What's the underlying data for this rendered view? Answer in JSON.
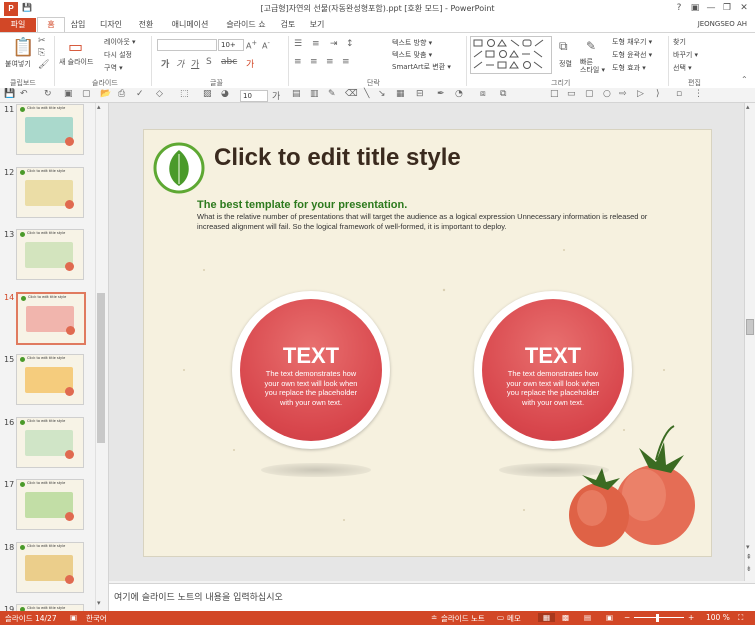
{
  "window": {
    "title": "[고급형]자연의 선물(자동완성형포함).ppt [호환 모드] - PowerPoint",
    "user": "JEONGSEO AH",
    "controls": [
      "?",
      "▣",
      "—",
      "❐",
      "✕"
    ]
  },
  "tabs": [
    {
      "label": "파일"
    },
    {
      "label": "홈"
    },
    {
      "label": "삽입"
    },
    {
      "label": "디자인"
    },
    {
      "label": "전환"
    },
    {
      "label": "애니메이션"
    },
    {
      "label": "슬라이드 쇼"
    },
    {
      "label": "검토"
    },
    {
      "label": "보기"
    }
  ],
  "ribbon": {
    "clipboard": {
      "paste": "붙여넣기",
      "group": "클립보드"
    },
    "slides": {
      "new_slide": "새 슬라이드",
      "layout": "레이아웃 ▾",
      "reset": "다시 설정",
      "section": "구역 ▾",
      "group": "슬라이드"
    },
    "font": {
      "size": "10+",
      "group": "글꼴"
    },
    "paragraph": {
      "text_direction": "텍스트 방향 ▾",
      "align_text": "텍스트 맞춤 ▾",
      "smartart": "SmartArt로 변환 ▾",
      "group": "단락"
    },
    "drawing": {
      "arrange": "정렬",
      "quick_styles": "빠른\n스타일 ▾",
      "fill": "도형 채우기 ▾",
      "outline": "도형 윤곽선 ▾",
      "effects": "도형 효과 ▾",
      "group": "그리기"
    },
    "editing": {
      "find": "찾기",
      "replace": "바꾸기 ▾",
      "select": "선택 ▾",
      "group": "편집"
    }
  },
  "qat": {
    "font_size": "10"
  },
  "thumbnails": [
    {
      "num": "11",
      "selected": false
    },
    {
      "num": "12",
      "selected": false
    },
    {
      "num": "13",
      "selected": false
    },
    {
      "num": "14",
      "selected": true
    },
    {
      "num": "15",
      "selected": false
    },
    {
      "num": "16",
      "selected": false
    },
    {
      "num": "17",
      "selected": false
    },
    {
      "num": "18",
      "selected": false
    },
    {
      "num": "19",
      "selected": false
    }
  ],
  "thumb_caption": "Click to edit title style",
  "slide": {
    "title": "Click to edit title style",
    "subtitle": "The best template for your presentation.",
    "body": "What is the relative number of presentations that will target the audience as a logical expression Unnecessary information is released or increased alignment will fail. So the logical framework of well-formed, it is important to deploy.",
    "circles": [
      {
        "title": "TEXT",
        "body": "The text demonstrates how your own text will look when you replace the placeholder with your own text."
      },
      {
        "title": "TEXT",
        "body": "The text demonstrates how your own text will look when you replace the placeholder with your own text."
      }
    ]
  },
  "notes": {
    "placeholder": "여기에 슬라이드 노트의 내용을 입력하십시오"
  },
  "status": {
    "slide_pos": "슬라이드 14/27",
    "language": "한국어",
    "notes_btn": "슬라이드 노트",
    "comments_btn": "메모",
    "zoom": "100 %"
  },
  "colors": {
    "accent": "#d24726",
    "circle": "#d8464c",
    "title": "#3a2a1e",
    "subtitle": "#2d7a1e"
  }
}
